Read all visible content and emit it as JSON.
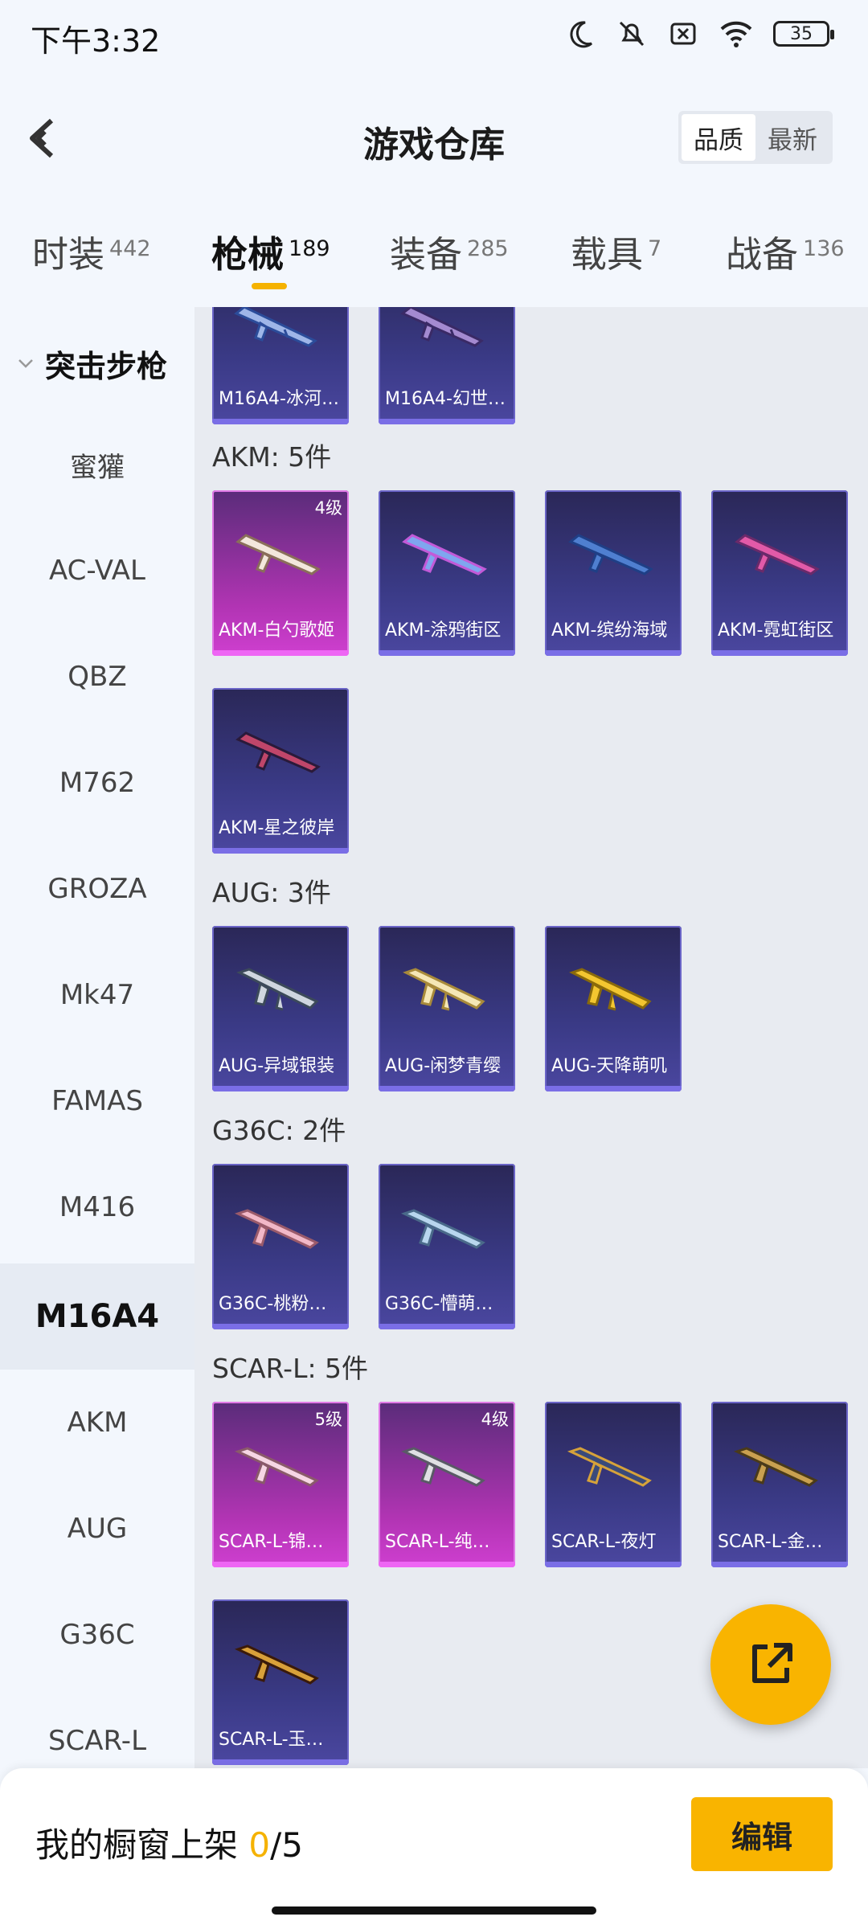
{
  "status": {
    "time": "下午3:32",
    "battery": "35"
  },
  "header": {
    "title": "游戏仓库",
    "sort": [
      "品质",
      "最新"
    ]
  },
  "tabs": [
    {
      "label": "时装",
      "count": "442"
    },
    {
      "label": "枪械",
      "count": "189"
    },
    {
      "label": "装备",
      "count": "285"
    },
    {
      "label": "载具",
      "count": "7"
    },
    {
      "label": "战备",
      "count": "136"
    }
  ],
  "sidebar": {
    "group": "突击步枪",
    "items": [
      "蜜獾",
      "AC-VAL",
      "QBZ",
      "M762",
      "GROZA",
      "Mk47",
      "FAMAS",
      "M416",
      "M16A4",
      "AKM",
      "AUG",
      "G36C",
      "SCAR-L"
    ]
  },
  "content": {
    "m16a4": {
      "cards": [
        {
          "name": "M16A4-冰河…"
        },
        {
          "name": "M16A4-幻世…"
        }
      ]
    },
    "akm": {
      "title": "AKM: 5件",
      "cards": [
        {
          "name": "AKM-白勺歌姬",
          "level": "4级"
        },
        {
          "name": "AKM-涂鸦街区"
        },
        {
          "name": "AKM-缤纷海域"
        },
        {
          "name": "AKM-霓虹街区"
        },
        {
          "name": "AKM-星之彼岸"
        }
      ]
    },
    "aug": {
      "title": "AUG: 3件",
      "cards": [
        {
          "name": "AUG-异域银装"
        },
        {
          "name": "AUG-闲梦青缨"
        },
        {
          "name": "AUG-天降萌叽"
        }
      ]
    },
    "g36c": {
      "title": "G36C: 2件",
      "cards": [
        {
          "name": "G36C-桃粉…"
        },
        {
          "name": "G36C-懵萌…"
        }
      ]
    },
    "scarl": {
      "title": "SCAR-L: 5件",
      "cards": [
        {
          "name": "SCAR-L-锦…",
          "level": "5级"
        },
        {
          "name": "SCAR-L-纯…",
          "level": "4级"
        },
        {
          "name": "SCAR-L-夜灯"
        },
        {
          "name": "SCAR-L-金…"
        },
        {
          "name": "SCAR-L-玉…"
        }
      ]
    }
  },
  "bottom": {
    "shelf_label": "我的橱窗上架",
    "shelf_current": "0",
    "shelf_total": "/5",
    "edit": "编辑"
  }
}
